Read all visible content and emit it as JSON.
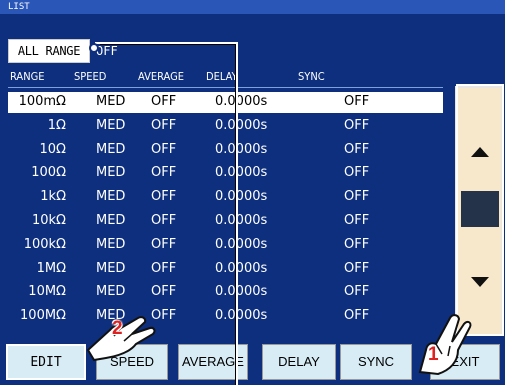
{
  "title": "LIST",
  "all_range": {
    "label": "ALL RANGE",
    "state": "OFF"
  },
  "columns": [
    "RANGE",
    "SPEED",
    "AVERAGE",
    "DELAY",
    "SYNC"
  ],
  "rows": [
    {
      "range": "100mΩ",
      "speed": "MED",
      "average": "OFF",
      "delay": "0.0000s",
      "sync": "OFF",
      "selected": true
    },
    {
      "range": "1Ω",
      "speed": "MED",
      "average": "OFF",
      "delay": "0.0000s",
      "sync": "OFF"
    },
    {
      "range": "10Ω",
      "speed": "MED",
      "average": "OFF",
      "delay": "0.0000s",
      "sync": "OFF"
    },
    {
      "range": "100Ω",
      "speed": "MED",
      "average": "OFF",
      "delay": "0.0000s",
      "sync": "OFF"
    },
    {
      "range": "1kΩ",
      "speed": "MED",
      "average": "OFF",
      "delay": "0.0000s",
      "sync": "OFF"
    },
    {
      "range": "10kΩ",
      "speed": "MED",
      "average": "OFF",
      "delay": "0.0000s",
      "sync": "OFF"
    },
    {
      "range": "100kΩ",
      "speed": "MED",
      "average": "OFF",
      "delay": "0.0000s",
      "sync": "OFF"
    },
    {
      "range": "1MΩ",
      "speed": "MED",
      "average": "OFF",
      "delay": "0.0000s",
      "sync": "OFF"
    },
    {
      "range": "10MΩ",
      "speed": "MED",
      "average": "OFF",
      "delay": "0.0000s",
      "sync": "OFF"
    },
    {
      "range": "100MΩ",
      "speed": "MED",
      "average": "OFF",
      "delay": "0.0000s",
      "sync": "OFF"
    }
  ],
  "buttons": {
    "edit": "EDIT",
    "speed": "SPEED",
    "average": "AVERAGE",
    "delay": "DELAY",
    "sync": "SYNC",
    "exit": "EXIT"
  },
  "markers": {
    "one": "1",
    "two": "2"
  },
  "icons": {
    "scroll_up": "triangle-up-icon",
    "scroll_down": "triangle-down-icon",
    "hand": "pointing-hand-icon"
  },
  "colors": {
    "background": "#0d2f7d",
    "title_bar": "#2a56b8",
    "button": "#d8ecf5",
    "scroll_panel": "#f7e8cc",
    "marker": "#d22222"
  }
}
